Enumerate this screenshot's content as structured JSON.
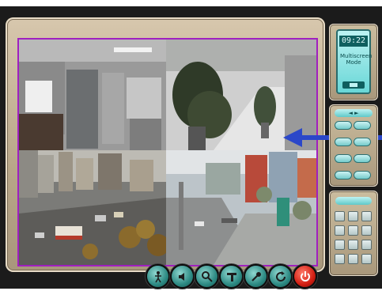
{
  "monitor": {
    "channels": [
      {
        "id": 1,
        "scene": "office room"
      },
      {
        "id": 2,
        "scene": "indoor plants corridor"
      },
      {
        "id": 3,
        "scene": "city street traffic"
      },
      {
        "id": 4,
        "scene": "city plaza"
      }
    ],
    "pointer": "arrow pointing at channel 2"
  },
  "side_panel": {
    "clock_display": "09:22",
    "display_text": "Multiscreen Mode",
    "ptz_pager_label": "◄ ►"
  },
  "toolbar": {
    "buttons": [
      {
        "icon": "ptz-person-icon"
      },
      {
        "icon": "audio-icon"
      },
      {
        "icon": "search-icon"
      },
      {
        "icon": "tools-icon"
      },
      {
        "icon": "settings-wrench-icon"
      },
      {
        "icon": "refresh-icon"
      },
      {
        "icon": "power-icon",
        "color": "#d21e12"
      }
    ]
  },
  "colors": {
    "viewer_border": "#a020c0",
    "arrow": "#2b47c9",
    "lcd": "#66d6d6"
  }
}
